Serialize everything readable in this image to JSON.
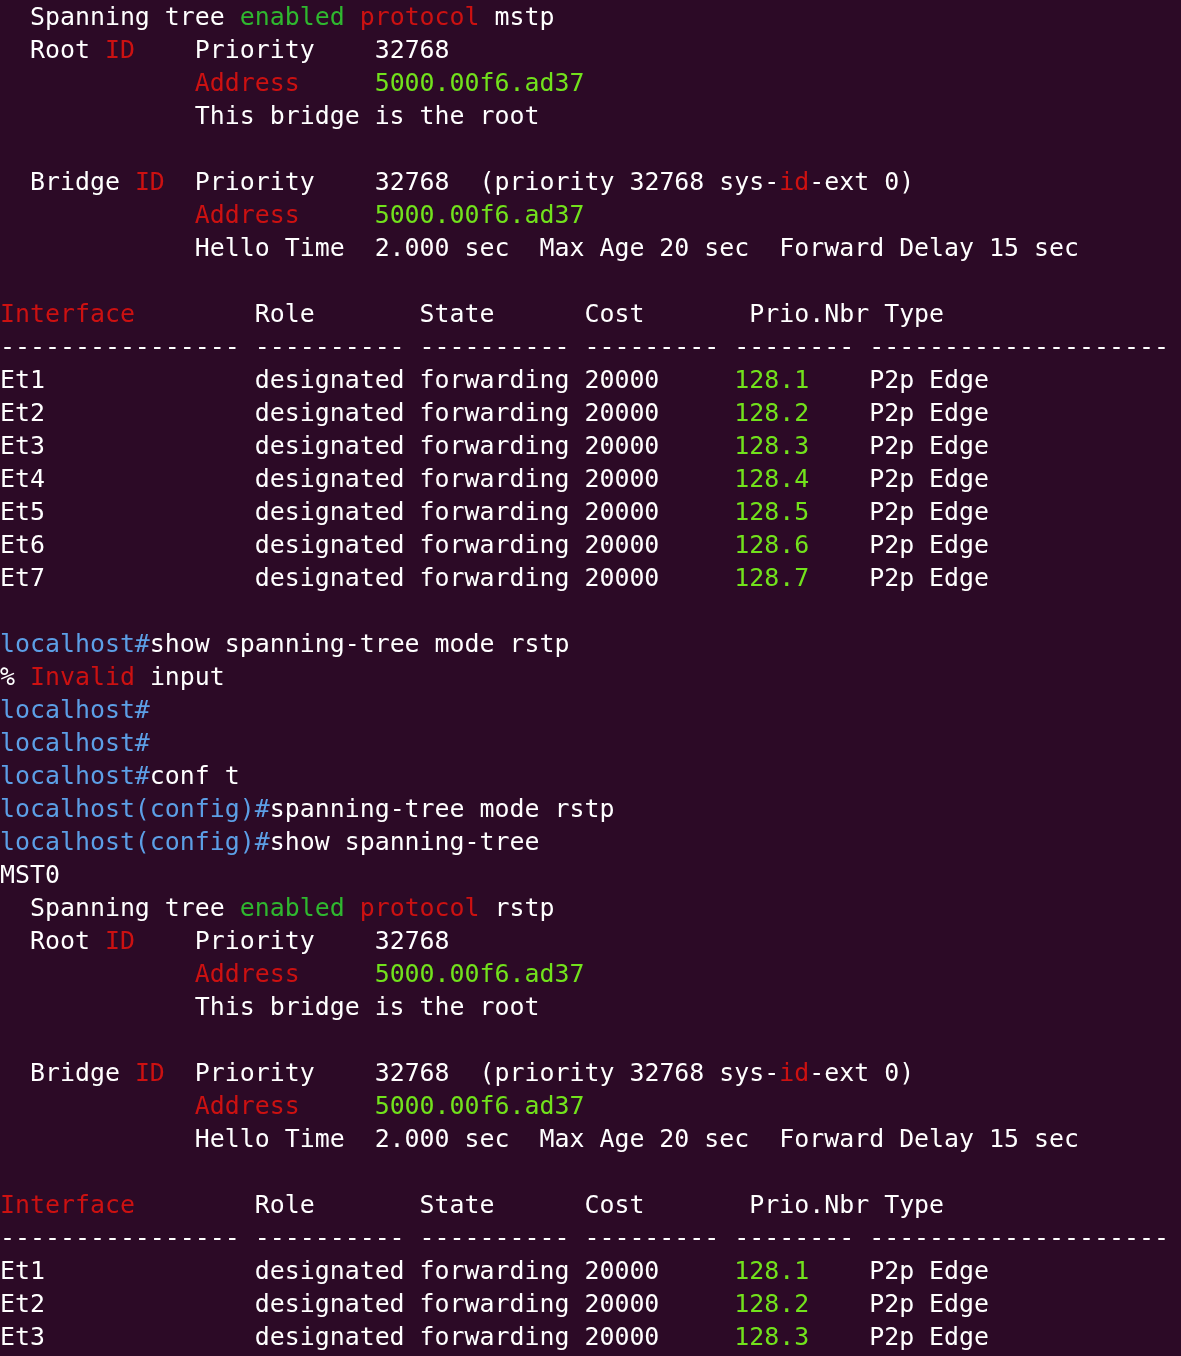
{
  "terminal": {
    "lines": [
      {
        "kind": "text",
        "segments": [
          {
            "text": "  Spanning tree ",
            "color": "#ffffff"
          },
          {
            "text": "enabled ",
            "color": "#2fb82f"
          },
          {
            "text": "protocol",
            "color": "#cc1111"
          },
          {
            "text": " mstp",
            "color": "#ffffff"
          }
        ]
      },
      {
        "kind": "text",
        "segments": [
          {
            "text": "  Root ",
            "color": "#ffffff"
          },
          {
            "text": "ID",
            "color": "#cc1111"
          },
          {
            "text": "    Priority    32768",
            "color": "#ffffff"
          }
        ]
      },
      {
        "kind": "text",
        "segments": [
          {
            "text": "             Address     ",
            "color": "#cc1111"
          },
          {
            "text": "5000.00f6.ad37",
            "color": "#72e21c"
          }
        ]
      },
      {
        "kind": "text",
        "segments": [
          {
            "text": "             This bridge is the root",
            "color": "#ffffff"
          }
        ]
      },
      {
        "kind": "blank"
      },
      {
        "kind": "text",
        "segments": [
          {
            "text": "  Bridge ",
            "color": "#ffffff"
          },
          {
            "text": "ID",
            "color": "#cc1111"
          },
          {
            "text": "  Priority    32768  (priority 32768 sys-",
            "color": "#ffffff"
          },
          {
            "text": "id",
            "color": "#cc1111"
          },
          {
            "text": "-ext 0)",
            "color": "#ffffff"
          }
        ]
      },
      {
        "kind": "text",
        "segments": [
          {
            "text": "             Address     ",
            "color": "#cc1111"
          },
          {
            "text": "5000.00f6.ad37",
            "color": "#72e21c"
          }
        ]
      },
      {
        "kind": "text",
        "segments": [
          {
            "text": "             Hello Time  2.000 sec  Max Age 20 sec  Forward Delay 15 sec",
            "color": "#ffffff"
          }
        ]
      },
      {
        "kind": "blank"
      },
      {
        "kind": "text",
        "segments": [
          {
            "text": "Interface",
            "color": "#cc1111"
          },
          {
            "text": "        Role       State      Cost       Prio.Nbr Type",
            "color": "#ffffff"
          }
        ]
      },
      {
        "kind": "text",
        "segments": [
          {
            "text": "---------------- ---------- ---------- --------- -------- --------------------",
            "color": "#ffffff"
          }
        ]
      },
      {
        "kind": "text",
        "segments": [
          {
            "text": "Et1              designated forwarding 20000     ",
            "color": "#ffffff"
          },
          {
            "text": "128.1",
            "color": "#72e21c"
          },
          {
            "text": "    P2p Edge",
            "color": "#ffffff"
          }
        ]
      },
      {
        "kind": "text",
        "segments": [
          {
            "text": "Et2              designated forwarding 20000     ",
            "color": "#ffffff"
          },
          {
            "text": "128.2",
            "color": "#72e21c"
          },
          {
            "text": "    P2p Edge",
            "color": "#ffffff"
          }
        ]
      },
      {
        "kind": "text",
        "segments": [
          {
            "text": "Et3              designated forwarding 20000     ",
            "color": "#ffffff"
          },
          {
            "text": "128.3",
            "color": "#72e21c"
          },
          {
            "text": "    P2p Edge",
            "color": "#ffffff"
          }
        ]
      },
      {
        "kind": "text",
        "segments": [
          {
            "text": "Et4              designated forwarding 20000     ",
            "color": "#ffffff"
          },
          {
            "text": "128.4",
            "color": "#72e21c"
          },
          {
            "text": "    P2p Edge",
            "color": "#ffffff"
          }
        ]
      },
      {
        "kind": "text",
        "segments": [
          {
            "text": "Et5              designated forwarding 20000     ",
            "color": "#ffffff"
          },
          {
            "text": "128.5",
            "color": "#72e21c"
          },
          {
            "text": "    P2p Edge",
            "color": "#ffffff"
          }
        ]
      },
      {
        "kind": "text",
        "segments": [
          {
            "text": "Et6              designated forwarding 20000     ",
            "color": "#ffffff"
          },
          {
            "text": "128.6",
            "color": "#72e21c"
          },
          {
            "text": "    P2p Edge",
            "color": "#ffffff"
          }
        ]
      },
      {
        "kind": "text",
        "segments": [
          {
            "text": "Et7              designated forwarding 20000     ",
            "color": "#ffffff"
          },
          {
            "text": "128.7",
            "color": "#72e21c"
          },
          {
            "text": "    P2p Edge",
            "color": "#ffffff"
          }
        ]
      },
      {
        "kind": "blank"
      },
      {
        "kind": "text",
        "segments": [
          {
            "text": "localhost#",
            "color": "#5c9fe6"
          },
          {
            "text": "show spanning-tree mode rstp",
            "color": "#ffffff"
          }
        ]
      },
      {
        "kind": "text",
        "segments": [
          {
            "text": "% ",
            "color": "#ffffff"
          },
          {
            "text": "Invalid",
            "color": "#cc1111"
          },
          {
            "text": " input",
            "color": "#ffffff"
          }
        ]
      },
      {
        "kind": "text",
        "segments": [
          {
            "text": "localhost#",
            "color": "#5c9fe6"
          }
        ]
      },
      {
        "kind": "text",
        "segments": [
          {
            "text": "localhost#",
            "color": "#5c9fe6"
          }
        ]
      },
      {
        "kind": "text",
        "segments": [
          {
            "text": "localhost#",
            "color": "#5c9fe6"
          },
          {
            "text": "conf t",
            "color": "#ffffff"
          }
        ]
      },
      {
        "kind": "text",
        "segments": [
          {
            "text": "localhost(config)#",
            "color": "#5c9fe6"
          },
          {
            "text": "spanning-tree mode rstp",
            "color": "#ffffff"
          }
        ]
      },
      {
        "kind": "text",
        "segments": [
          {
            "text": "localhost(config)#",
            "color": "#5c9fe6"
          },
          {
            "text": "show spanning-tree",
            "color": "#ffffff"
          }
        ]
      },
      {
        "kind": "text",
        "segments": [
          {
            "text": "MST0",
            "color": "#ffffff"
          }
        ]
      },
      {
        "kind": "text",
        "segments": [
          {
            "text": "  Spanning tree ",
            "color": "#ffffff"
          },
          {
            "text": "enabled ",
            "color": "#2fb82f"
          },
          {
            "text": "protocol",
            "color": "#cc1111"
          },
          {
            "text": " rstp",
            "color": "#ffffff"
          }
        ]
      },
      {
        "kind": "text",
        "segments": [
          {
            "text": "  Root ",
            "color": "#ffffff"
          },
          {
            "text": "ID",
            "color": "#cc1111"
          },
          {
            "text": "    Priority    32768",
            "color": "#ffffff"
          }
        ]
      },
      {
        "kind": "text",
        "segments": [
          {
            "text": "             Address     ",
            "color": "#cc1111"
          },
          {
            "text": "5000.00f6.ad37",
            "color": "#72e21c"
          }
        ]
      },
      {
        "kind": "text",
        "segments": [
          {
            "text": "             This bridge is the root",
            "color": "#ffffff"
          }
        ]
      },
      {
        "kind": "blank"
      },
      {
        "kind": "text",
        "segments": [
          {
            "text": "  Bridge ",
            "color": "#ffffff"
          },
          {
            "text": "ID",
            "color": "#cc1111"
          },
          {
            "text": "  Priority    32768  (priority 32768 sys-",
            "color": "#ffffff"
          },
          {
            "text": "id",
            "color": "#cc1111"
          },
          {
            "text": "-ext 0)",
            "color": "#ffffff"
          }
        ]
      },
      {
        "kind": "text",
        "segments": [
          {
            "text": "             Address     ",
            "color": "#cc1111"
          },
          {
            "text": "5000.00f6.ad37",
            "color": "#72e21c"
          }
        ]
      },
      {
        "kind": "text",
        "segments": [
          {
            "text": "             Hello Time  2.000 sec  Max Age 20 sec  Forward Delay 15 sec",
            "color": "#ffffff"
          }
        ]
      },
      {
        "kind": "blank"
      },
      {
        "kind": "text",
        "segments": [
          {
            "text": "Interface",
            "color": "#cc1111"
          },
          {
            "text": "        Role       State      Cost       Prio.Nbr Type",
            "color": "#ffffff"
          }
        ]
      },
      {
        "kind": "text",
        "segments": [
          {
            "text": "---------------- ---------- ---------- --------- -------- --------------------",
            "color": "#ffffff"
          }
        ]
      },
      {
        "kind": "text",
        "segments": [
          {
            "text": "Et1              designated forwarding 20000     ",
            "color": "#ffffff"
          },
          {
            "text": "128.1",
            "color": "#72e21c"
          },
          {
            "text": "    P2p Edge",
            "color": "#ffffff"
          }
        ]
      },
      {
        "kind": "text",
        "segments": [
          {
            "text": "Et2              designated forwarding 20000     ",
            "color": "#ffffff"
          },
          {
            "text": "128.2",
            "color": "#72e21c"
          },
          {
            "text": "    P2p Edge",
            "color": "#ffffff"
          }
        ]
      },
      {
        "kind": "text",
        "segments": [
          {
            "text": "Et3              designated forwarding 20000     ",
            "color": "#ffffff"
          },
          {
            "text": "128.3",
            "color": "#72e21c"
          },
          {
            "text": "    P2p Edge",
            "color": "#ffffff"
          }
        ]
      }
    ]
  }
}
